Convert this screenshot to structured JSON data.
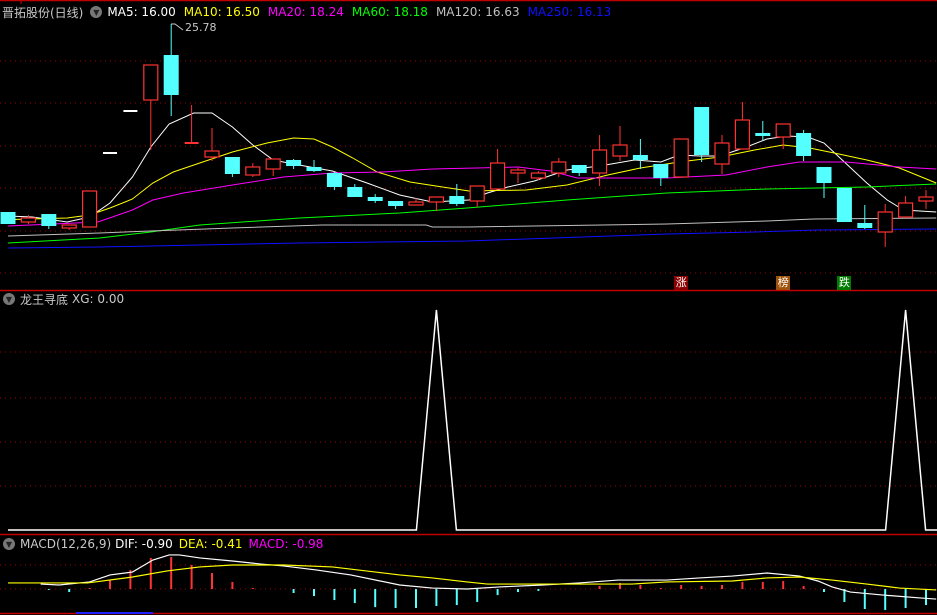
{
  "header": {
    "stock_name": "晋拓股份(日线)",
    "ma_labels": [
      {
        "text": "MA5: 16.00",
        "color": "#ffffff"
      },
      {
        "text": "MA10: 16.50",
        "color": "#ffff00"
      },
      {
        "text": "MA20: 18.24",
        "color": "#ff00ff"
      },
      {
        "text": "MA60: 18.18",
        "color": "#00ff00"
      },
      {
        "text": "MA120: 16.63",
        "color": "#c0c0c0"
      },
      {
        "text": "MA250: 16.13",
        "color": "#1010ff"
      }
    ],
    "max_price_label": "25.78"
  },
  "badges": [
    {
      "text": "涨",
      "color": "#8b0000",
      "index": 33
    },
    {
      "text": "榜",
      "color": "#a0520a",
      "index": 38
    },
    {
      "text": "跌",
      "color": "#007a00",
      "index": 41
    }
  ],
  "indicator": {
    "title": "龙王寻底",
    "value_label": "XG: 0.00"
  },
  "macd": {
    "title": "MACD(12,26,9)",
    "dif_label": "DIF: -0.90",
    "dea_label": "DEA: -0.41",
    "macd_label": "MACD: -0.98"
  },
  "colors": {
    "up": "#ff3333",
    "down": "#54ffff",
    "grid": "#a00000"
  },
  "chart_data": [
    {
      "type": "candlestick",
      "title": "晋拓股份(日线)",
      "ylim": [
        14.0,
        26.98
      ],
      "candles_ohlc": [
        [
          16.38,
          15.78,
          16.38,
          15.78
        ],
        [
          15.88,
          16.08,
          16.23,
          15.78
        ],
        [
          16.28,
          15.68,
          16.28,
          15.53
        ],
        [
          15.58,
          15.73,
          15.73,
          15.48
        ],
        [
          15.63,
          17.43,
          17.43,
          15.63
        ],
        [
          19.33,
          19.33,
          19.33,
          19.33
        ],
        [
          21.43,
          21.43,
          21.43,
          21.43
        ],
        [
          21.98,
          23.73,
          23.73,
          19.48
        ],
        [
          24.23,
          22.23,
          25.78,
          21.18
        ],
        [
          19.83,
          19.83,
          21.73,
          19.83
        ],
        [
          19.13,
          19.43,
          20.58,
          18.93
        ],
        [
          19.13,
          18.28,
          19.13,
          18.13
        ],
        [
          18.23,
          18.63,
          18.83,
          18.13
        ],
        [
          18.53,
          19.03,
          19.03,
          18.18
        ],
        [
          18.98,
          18.68,
          19.03,
          18.53
        ],
        [
          18.63,
          18.43,
          18.98,
          18.38
        ],
        [
          18.33,
          17.63,
          18.38,
          17.48
        ],
        [
          17.63,
          17.13,
          17.78,
          17.13
        ],
        [
          17.13,
          16.93,
          17.28,
          16.83
        ],
        [
          16.93,
          16.68,
          16.93,
          16.53
        ],
        [
          16.73,
          16.88,
          17.08,
          16.73
        ],
        [
          16.88,
          17.13,
          17.13,
          16.43
        ],
        [
          17.18,
          16.78,
          17.78,
          16.68
        ],
        [
          16.93,
          17.68,
          17.68,
          16.63
        ],
        [
          17.53,
          18.83,
          19.53,
          17.53
        ],
        [
          18.33,
          18.48,
          18.58,
          17.83
        ],
        [
          18.08,
          18.33,
          18.43,
          17.98
        ],
        [
          18.33,
          18.88,
          19.08,
          18.13
        ],
        [
          18.73,
          18.33,
          18.73,
          18.18
        ],
        [
          18.33,
          19.48,
          20.23,
          17.68
        ],
        [
          19.18,
          19.73,
          20.68,
          18.93
        ],
        [
          19.23,
          18.98,
          20.03,
          18.53
        ],
        [
          18.78,
          18.08,
          18.78,
          17.68
        ],
        [
          18.13,
          20.03,
          20.03,
          18.13
        ],
        [
          21.63,
          19.23,
          21.63,
          18.88
        ],
        [
          18.78,
          19.83,
          20.23,
          18.28
        ],
        [
          19.53,
          20.98,
          21.88,
          19.53
        ],
        [
          20.33,
          20.18,
          20.93,
          19.98
        ],
        [
          20.13,
          20.78,
          20.78,
          19.53
        ],
        [
          20.33,
          19.18,
          20.48,
          18.93
        ],
        [
          18.63,
          17.83,
          18.63,
          17.08
        ],
        [
          17.58,
          15.88,
          17.58,
          15.88
        ],
        [
          15.83,
          15.58,
          16.73,
          15.53
        ],
        [
          15.38,
          16.38,
          16.78,
          14.63
        ],
        [
          16.13,
          16.83,
          17.18,
          16.13
        ],
        [
          16.93,
          17.13,
          17.48,
          16.53
        ]
      ],
      "series": [
        {
          "name": "MA5",
          "color": "#ffffff",
          "points": [
            [
              0,
              16.18
            ],
            [
              1.2,
              16.13
            ],
            [
              2.9,
              15.88
            ],
            [
              4,
              16.13
            ],
            [
              5,
              16.83
            ],
            [
              6.1,
              18.13
            ],
            [
              7,
              19.63
            ],
            [
              7.9,
              20.78
            ],
            [
              9.1,
              21.33
            ],
            [
              10,
              21.33
            ],
            [
              11,
              20.63
            ],
            [
              12,
              19.73
            ],
            [
              13,
              18.98
            ],
            [
              14,
              18.78
            ],
            [
              15.9,
              18.43
            ],
            [
              17.6,
              17.83
            ],
            [
              19.2,
              17.23
            ],
            [
              20.8,
              16.88
            ],
            [
              22.6,
              16.98
            ],
            [
              23.5,
              17.33
            ],
            [
              24.5,
              17.63
            ],
            [
              25.8,
              17.93
            ],
            [
              27.4,
              18.48
            ],
            [
              29,
              18.68
            ],
            [
              30.7,
              18.98
            ],
            [
              32,
              18.88
            ],
            [
              32.9,
              19.23
            ],
            [
              33.9,
              19.18
            ],
            [
              34.9,
              19.18
            ],
            [
              36.2,
              19.63
            ],
            [
              37.2,
              20.03
            ],
            [
              38.2,
              20.18
            ],
            [
              39.2,
              20.13
            ],
            [
              40,
              19.83
            ],
            [
              41,
              18.88
            ],
            [
              42.1,
              17.83
            ],
            [
              43.1,
              16.98
            ],
            [
              43.9,
              16.48
            ],
            [
              45.5,
              16.38
            ]
          ]
        },
        {
          "name": "MA10",
          "color": "#ffff00",
          "points": [
            [
              0,
              16.0
            ],
            [
              2.9,
              16.08
            ],
            [
              4,
              16.23
            ],
            [
              5,
              16.58
            ],
            [
              6.1,
              17.03
            ],
            [
              7.1,
              17.83
            ],
            [
              8.1,
              18.38
            ],
            [
              9.4,
              18.83
            ],
            [
              11,
              19.38
            ],
            [
              12.7,
              19.83
            ],
            [
              14,
              20.08
            ],
            [
              15,
              20.03
            ],
            [
              15.9,
              19.63
            ],
            [
              16.9,
              19.08
            ],
            [
              18.1,
              18.38
            ],
            [
              19.7,
              17.88
            ],
            [
              21.3,
              17.63
            ],
            [
              22.6,
              17.43
            ],
            [
              25.4,
              17.48
            ],
            [
              27.4,
              17.73
            ],
            [
              29.4,
              18.23
            ],
            [
              31,
              18.58
            ],
            [
              32.9,
              18.88
            ],
            [
              34.9,
              19.13
            ],
            [
              36.6,
              19.48
            ],
            [
              38,
              19.73
            ],
            [
              39.3,
              19.58
            ],
            [
              40.5,
              19.33
            ],
            [
              42.1,
              18.98
            ],
            [
              43.7,
              18.58
            ],
            [
              45.5,
              17.83
            ]
          ]
        },
        {
          "name": "MA20",
          "color": "#ff00ff",
          "points": [
            [
              0,
              15.68
            ],
            [
              4.4,
              15.88
            ],
            [
              6.1,
              16.48
            ],
            [
              7.1,
              16.98
            ],
            [
              8.6,
              17.33
            ],
            [
              11,
              17.73
            ],
            [
              13.5,
              18.13
            ],
            [
              15.9,
              18.33
            ],
            [
              18.4,
              18.38
            ],
            [
              20.8,
              18.53
            ],
            [
              25,
              18.63
            ],
            [
              26.6,
              18.43
            ],
            [
              27.9,
              18.08
            ],
            [
              32.3,
              18.08
            ],
            [
              35.2,
              18.23
            ],
            [
              37.2,
              18.63
            ],
            [
              38.8,
              18.88
            ],
            [
              41.1,
              18.88
            ],
            [
              43.7,
              18.63
            ],
            [
              45.5,
              18.53
            ]
          ]
        },
        {
          "name": "MA60",
          "color": "#00ff00",
          "points": [
            [
              0,
              14.83
            ],
            [
              4.5,
              15.08
            ],
            [
              7,
              15.38
            ],
            [
              9.4,
              15.73
            ],
            [
              14.3,
              16.08
            ],
            [
              19.2,
              16.33
            ],
            [
              22.5,
              16.58
            ],
            [
              27.4,
              16.98
            ],
            [
              32.3,
              17.33
            ],
            [
              37.2,
              17.53
            ],
            [
              42.1,
              17.63
            ],
            [
              45.5,
              17.78
            ]
          ]
        },
        {
          "name": "MA120",
          "color": "#c0c0c0",
          "points": [
            [
              0,
              15.18
            ],
            [
              4.5,
              15.33
            ],
            [
              7,
              15.43
            ],
            [
              11,
              15.58
            ],
            [
              15.4,
              15.73
            ],
            [
              20.5,
              15.73
            ],
            [
              20.8,
              15.63
            ],
            [
              22.5,
              15.63
            ],
            [
              32.3,
              15.78
            ],
            [
              37.2,
              15.93
            ],
            [
              39.5,
              16.03
            ],
            [
              45.5,
              16.08
            ]
          ]
        },
        {
          "name": "MA250",
          "color": "#1010ff",
          "points": [
            [
              0,
              14.58
            ],
            [
              4.5,
              14.63
            ],
            [
              9.4,
              14.73
            ],
            [
              14.3,
              14.83
            ],
            [
              22.5,
              14.93
            ],
            [
              32.3,
              15.28
            ],
            [
              36.6,
              15.38
            ],
            [
              39.7,
              15.48
            ],
            [
              45.5,
              15.53
            ]
          ]
        }
      ]
    },
    {
      "type": "line",
      "title": "龙王寻底",
      "series": [
        {
          "name": "XG",
          "color": "#ffffff",
          "signal_indices": [
            21,
            44
          ]
        }
      ],
      "ylim": [
        0,
        1
      ]
    },
    {
      "type": "bar",
      "title": "MACD(12,26,9)",
      "ylim": [
        -1.5,
        3.0
      ],
      "macd_bars": [
        0,
        0,
        -0.06,
        -0.19,
        0.06,
        0.56,
        1.19,
        1.94,
        2.0,
        1.5,
        1.0,
        0.44,
        0.06,
        0,
        -0.25,
        -0.44,
        -0.69,
        -0.88,
        -1.13,
        -1.19,
        -1.19,
        -1.06,
        -1.0,
        -0.81,
        -0.38,
        -0.19,
        -0.12,
        0,
        0,
        0.19,
        0.38,
        0.25,
        0.06,
        0.25,
        0.19,
        0.25,
        0.44,
        0.44,
        0.5,
        0.19,
        -0.19,
        -0.81,
        -1.25,
        -1.31,
        -1.19,
        -1.0
      ],
      "series": [
        {
          "name": "DIF",
          "color": "#ffffff",
          "points": [
            [
              1.6,
              0.31
            ],
            [
              2.5,
              0.25
            ],
            [
              4,
              0.44
            ],
            [
              5,
              0.88
            ],
            [
              6.1,
              1.06
            ],
            [
              7.1,
              1.81
            ],
            [
              7.9,
              2.13
            ],
            [
              8.4,
              2.13
            ],
            [
              9.4,
              1.94
            ],
            [
              11,
              1.75
            ],
            [
              12.4,
              1.56
            ],
            [
              13.5,
              1.44
            ],
            [
              15.1,
              1.19
            ],
            [
              16.8,
              0.88
            ],
            [
              19.2,
              0.25
            ],
            [
              20.8,
              0.06
            ],
            [
              22.5,
              0
            ],
            [
              24.1,
              0.13
            ],
            [
              26.2,
              0.25
            ],
            [
              28,
              0.38
            ],
            [
              29.9,
              0.56
            ],
            [
              32.3,
              0.56
            ],
            [
              33.9,
              0.69
            ],
            [
              35.5,
              0.81
            ],
            [
              37.2,
              1.0
            ],
            [
              38.8,
              0.81
            ],
            [
              39.7,
              0.5
            ],
            [
              40.4,
              0.13
            ],
            [
              41.3,
              -0.19
            ],
            [
              42.9,
              -0.38
            ],
            [
              44.7,
              -0.56
            ],
            [
              45.5,
              -0.63
            ]
          ]
        },
        {
          "name": "DEA",
          "color": "#ffff00",
          "points": [
            [
              0,
              0.38
            ],
            [
              3.9,
              0.38
            ],
            [
              6.1,
              0.75
            ],
            [
              7.8,
              1.13
            ],
            [
              9.4,
              1.38
            ],
            [
              11,
              1.5
            ],
            [
              13.5,
              1.5
            ],
            [
              15.9,
              1.38
            ],
            [
              19.2,
              0.88
            ],
            [
              20.8,
              0.69
            ],
            [
              22.5,
              0.44
            ],
            [
              23.5,
              0.31
            ],
            [
              30.6,
              0.31
            ],
            [
              32.3,
              0.44
            ],
            [
              35.5,
              0.5
            ],
            [
              37.2,
              0.69
            ],
            [
              38.8,
              0.75
            ],
            [
              40.4,
              0.56
            ],
            [
              42.1,
              0.31
            ],
            [
              43.7,
              0.06
            ],
            [
              45.5,
              -0.06
            ]
          ]
        }
      ]
    }
  ]
}
